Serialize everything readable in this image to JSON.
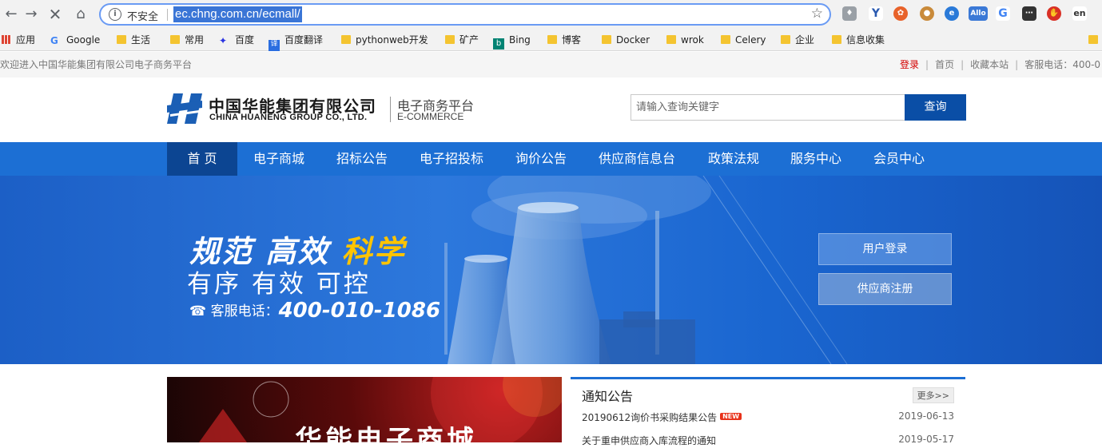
{
  "browser": {
    "insecure_label": "不安全",
    "url": "ec.chng.com.cn/ecmall/",
    "extensions": [
      "shield",
      "Y",
      "wheel",
      "cookie",
      "e",
      "Allo",
      "G",
      "dots",
      "stop",
      "en"
    ]
  },
  "bookmarks": [
    {
      "label": "应用",
      "icon": "apps-icon"
    },
    {
      "label": "Google",
      "icon": "google-icon"
    },
    {
      "label": "生活",
      "icon": "folder-icon"
    },
    {
      "label": "常用",
      "icon": "folder-icon"
    },
    {
      "label": "百度",
      "icon": "baidu-icon"
    },
    {
      "label": "百度翻译",
      "icon": "translate-icon"
    },
    {
      "label": "pythonweb开发",
      "icon": "folder-icon"
    },
    {
      "label": "矿产",
      "icon": "folder-icon"
    },
    {
      "label": "Bing",
      "icon": "bing-icon"
    },
    {
      "label": "博客",
      "icon": "folder-icon"
    },
    {
      "label": "Docker",
      "icon": "folder-icon"
    },
    {
      "label": "wrok",
      "icon": "folder-icon"
    },
    {
      "label": "Celery",
      "icon": "folder-icon"
    },
    {
      "label": "企业",
      "icon": "folder-icon"
    },
    {
      "label": "信息收集",
      "icon": "folder-icon"
    }
  ],
  "topbar": {
    "welcome": "欢迎进入中国华能集团有限公司电子商务平台",
    "login": "登录",
    "home": "首页",
    "favorite": "收藏本站",
    "hotline": "客服电话：400-0"
  },
  "header": {
    "logo_cn": "中国华能集团有限公司",
    "logo_en": "CHINA HUANENG GROUP CO., LTD.",
    "platform_cn": "电子商务平台",
    "platform_en": "E-COMMERCE",
    "search_placeholder": "请输入查询关键字",
    "search_button": "查询"
  },
  "nav": [
    "首 页",
    "电子商城",
    "招标公告",
    "电子招投标",
    "询价公告",
    "供应商信息台",
    "政策法规",
    "服务中心",
    "会员中心"
  ],
  "banner": {
    "slogan_a": "规范 高效 ",
    "slogan_b": "科学",
    "slogan2": "有序 有效 可控",
    "hotline_label": "客服电话：",
    "hotline_number": "400-010-1086",
    "login_button": "用户登录",
    "register_button": "供应商注册"
  },
  "promo": {
    "title": "华能电子商城"
  },
  "notice": {
    "title": "通知公告",
    "more": "更多>>",
    "new_badge": "NEW",
    "items": [
      {
        "title": "20190612询价书采购结果公告",
        "date": "2019-06-13"
      },
      {
        "title": "关于重申供应商入库流程的通知",
        "date": "2019-05-17"
      }
    ]
  }
}
